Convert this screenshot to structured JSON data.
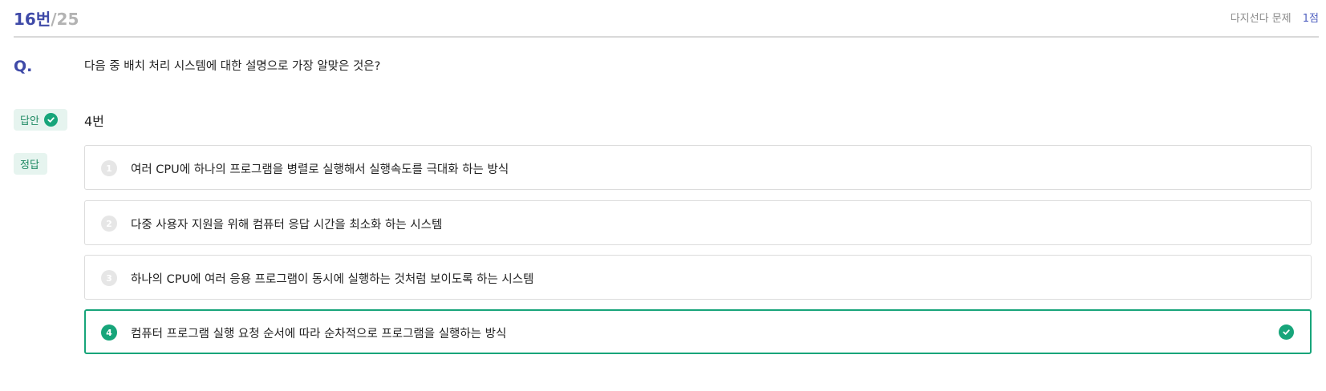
{
  "header": {
    "question_number": "16번",
    "question_total": "/25",
    "question_type": "다지선다 문제",
    "score": "1점"
  },
  "question": {
    "label": "Q.",
    "text": "다음 중 배치 처리 시스템에 대한 설명으로 가장 알맞은 것은?"
  },
  "answer": {
    "label": "답안",
    "value": "4번"
  },
  "correct": {
    "label": "정답"
  },
  "options": [
    {
      "number": "1",
      "text": "여러 CPU에 하나의 프로그램을 병렬로 실행해서 실행속도를 극대화 하는 방식"
    },
    {
      "number": "2",
      "text": "다중 사용자 지원을 위해 컴퓨터 응답 시간을 최소화 하는 시스템"
    },
    {
      "number": "3",
      "text": "하나의 CPU에 여러 응용 프로그램이 동시에 실행하는 것처럼 보이도록 하는 시스템"
    },
    {
      "number": "4",
      "text": "컴퓨터 프로그램 실행 요청 순서에 따라 순차적으로 프로그램을 실행하는 방식"
    }
  ],
  "colors": {
    "accent_blue": "#3f4aa8",
    "accent_green": "#17a57a"
  }
}
